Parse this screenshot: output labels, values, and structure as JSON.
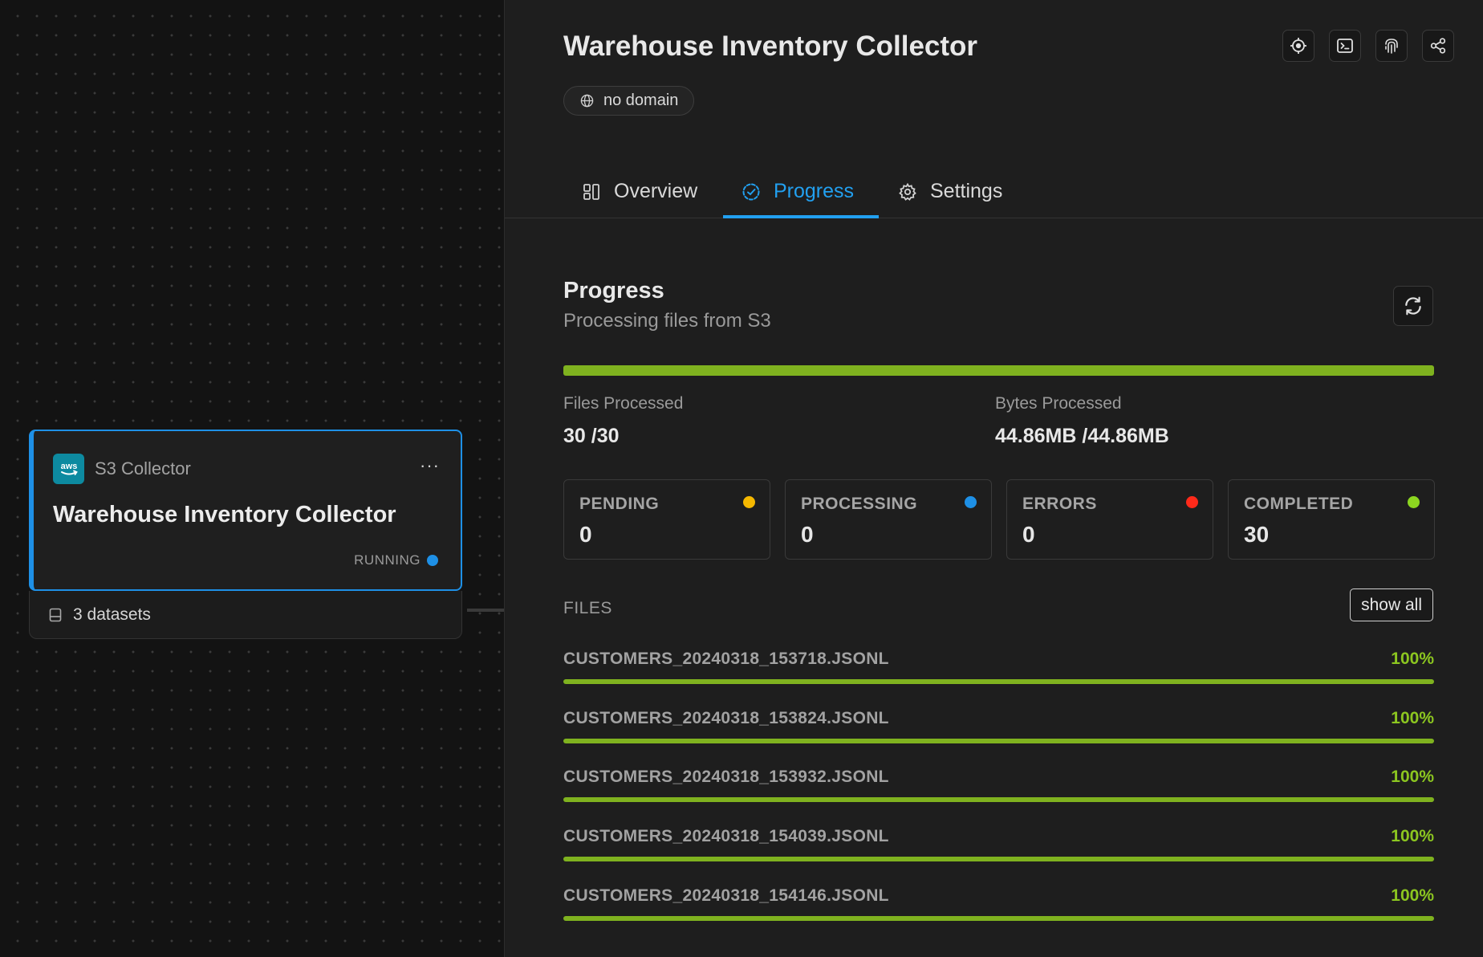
{
  "canvas": {
    "node": {
      "type_label": "S3 Collector",
      "badge_text": "aws",
      "title": "Warehouse Inventory Collector",
      "more_label": "···",
      "status": "RUNNING",
      "status_color": "#1e90e6",
      "datasets_label": "3 datasets"
    }
  },
  "panel": {
    "title": "Warehouse Inventory Collector",
    "domain_chip": "no domain",
    "toolbar": [
      "target-icon",
      "terminal-icon",
      "fingerprint-icon",
      "share-icon"
    ],
    "tabs": [
      {
        "label": "Overview",
        "icon": "overview-icon",
        "active": false
      },
      {
        "label": "Progress",
        "icon": "progress-icon",
        "active": true
      },
      {
        "label": "Settings",
        "icon": "gear-icon",
        "active": false
      }
    ],
    "progress": {
      "title": "Progress",
      "subtitle": "Processing files from S3",
      "overall_fraction": 1.0,
      "files_label": "Files Processed",
      "files_value": "30 /30",
      "bytes_label": "Bytes Processed",
      "bytes_value": "44.86MB /44.86MB",
      "counters": [
        {
          "label": "PENDING",
          "value": "0",
          "color": "#f5b800"
        },
        {
          "label": "PROCESSING",
          "value": "0",
          "color": "#1e90e6"
        },
        {
          "label": "ERRORS",
          "value": "0",
          "color": "#ff2a1a"
        },
        {
          "label": "COMPLETED",
          "value": "30",
          "color": "#8cd620"
        }
      ],
      "files_section_label": "FILES",
      "show_all_label": "show all",
      "files": [
        {
          "name": "CUSTOMERS_20240318_153718.JSONL",
          "percent_label": "100%",
          "fraction": 1.0
        },
        {
          "name": "CUSTOMERS_20240318_153824.JSONL",
          "percent_label": "100%",
          "fraction": 1.0
        },
        {
          "name": "CUSTOMERS_20240318_153932.JSONL",
          "percent_label": "100%",
          "fraction": 1.0
        },
        {
          "name": "CUSTOMERS_20240318_154039.JSONL",
          "percent_label": "100%",
          "fraction": 1.0
        },
        {
          "name": "CUSTOMERS_20240318_154146.JSONL",
          "percent_label": "100%",
          "fraction": 1.0
        }
      ]
    }
  },
  "colors": {
    "accent": "#22a0f0",
    "success": "#7fb21f",
    "success_text": "#8cc620"
  }
}
